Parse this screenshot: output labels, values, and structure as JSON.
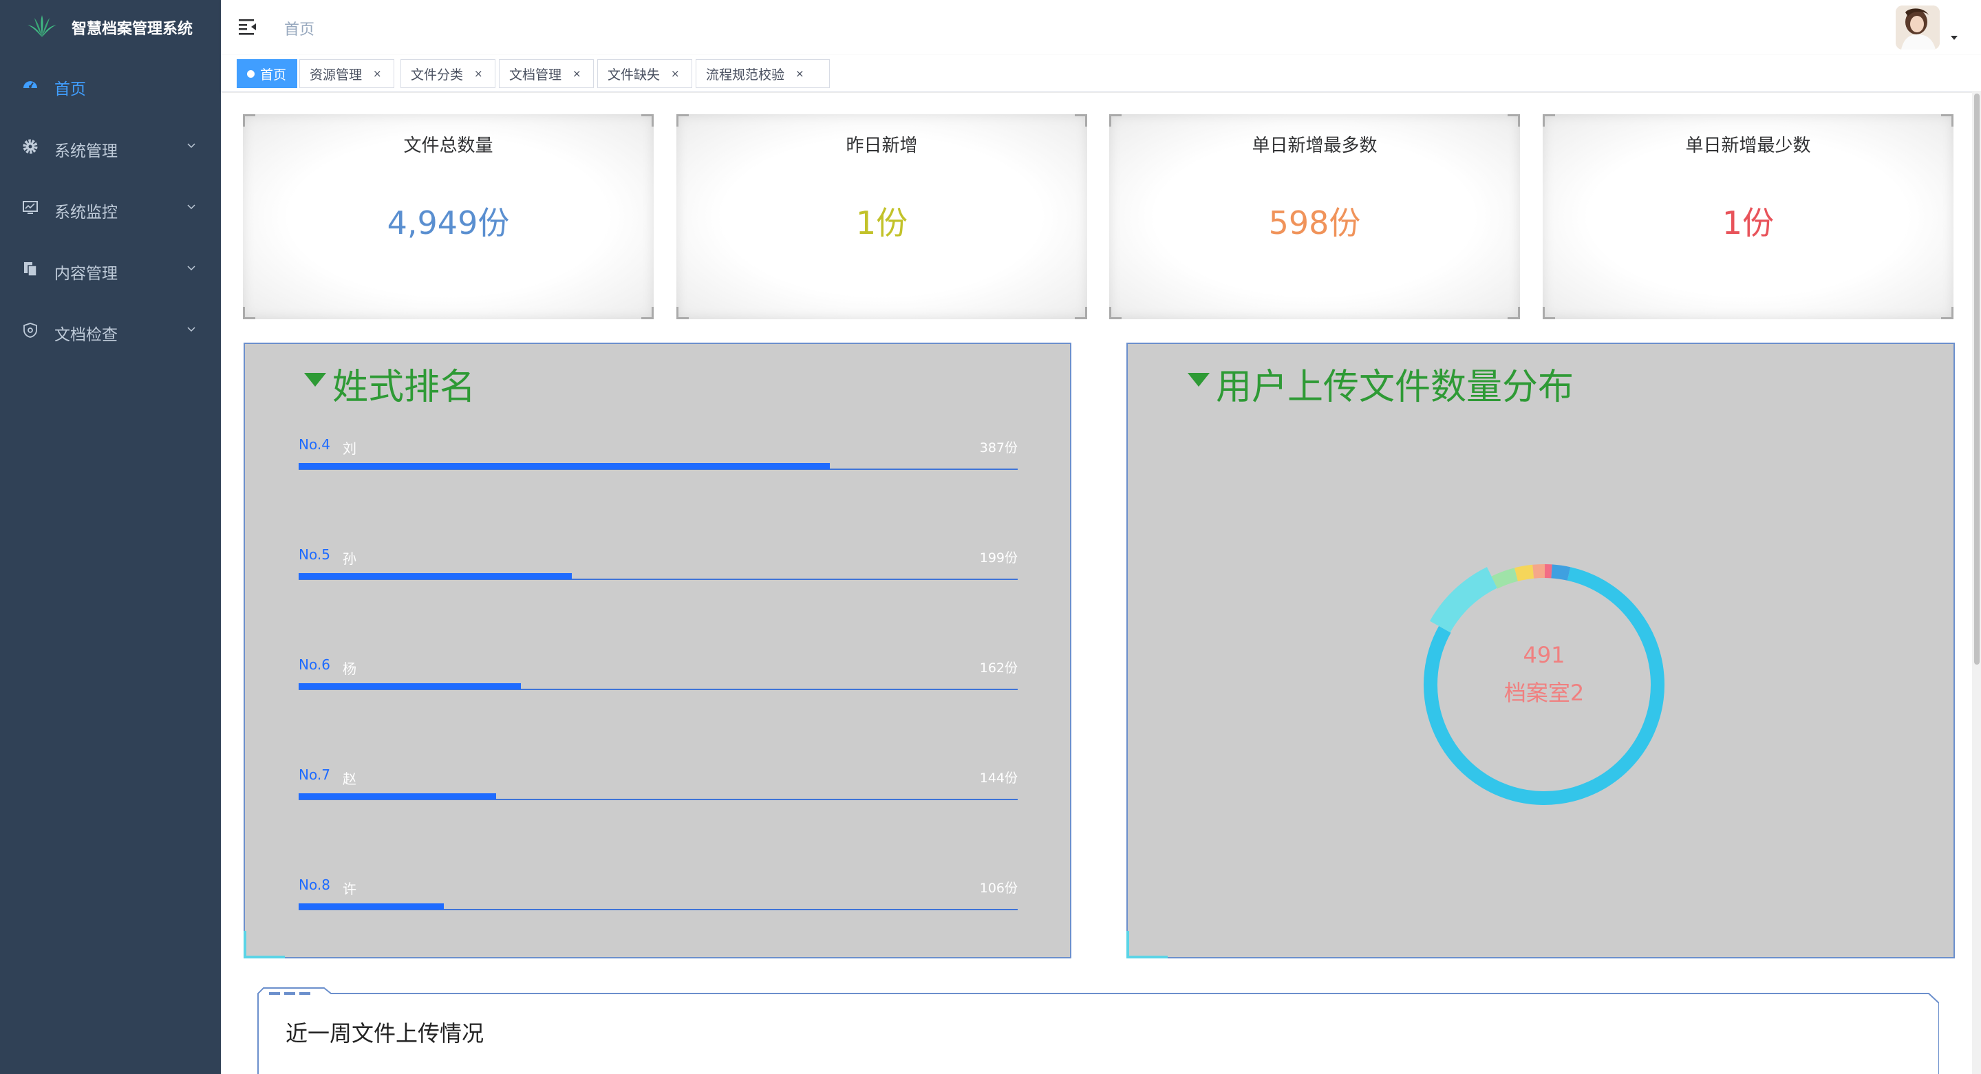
{
  "app": {
    "title": "智慧档案管理系统"
  },
  "sidebar": {
    "items": [
      {
        "label": "首页",
        "icon": "dashboard-icon",
        "active": true
      },
      {
        "label": "系统管理",
        "icon": "gear-icon"
      },
      {
        "label": "系统监控",
        "icon": "monitor-icon"
      },
      {
        "label": "内容管理",
        "icon": "documents-icon"
      },
      {
        "label": "文档检查",
        "icon": "shield-check-icon"
      }
    ]
  },
  "navbar": {
    "breadcrumb": "首页"
  },
  "tags": [
    {
      "label": "首页",
      "active": true
    },
    {
      "label": "资源管理",
      "close": "×"
    },
    {
      "label": "文件分类",
      "close": "×"
    },
    {
      "label": "文档管理",
      "close": "×"
    },
    {
      "label": "文件缺失",
      "close": "×"
    },
    {
      "label": "流程规范校验",
      "close": "×"
    }
  ],
  "stats": [
    {
      "title": "文件总数量",
      "value": "4,949份",
      "color": "#5a8fd0"
    },
    {
      "title": "昨日新增",
      "value": "1份",
      "color": "#c2c22a"
    },
    {
      "title": "单日新增最多数",
      "value": "598份",
      "color": "#f0935a"
    },
    {
      "title": "单日新增最少数",
      "value": "1份",
      "color": "#e8535a"
    }
  ],
  "surname_panel": {
    "title": "姓式排名",
    "items": [
      {
        "no": "No.4",
        "name": "刘",
        "value": "387份",
        "count": 387
      },
      {
        "no": "No.5",
        "name": "孙",
        "value": "199份",
        "count": 199
      },
      {
        "no": "No.6",
        "name": "杨",
        "value": "162份",
        "count": 162
      },
      {
        "no": "No.7",
        "name": "赵",
        "value": "144份",
        "count": 144
      },
      {
        "no": "No.8",
        "name": "许",
        "value": "106份",
        "count": 106
      }
    ]
  },
  "upload_panel": {
    "title": "用户上传文件数量分布",
    "center_value": "491",
    "center_label": "档案室2"
  },
  "chart_data": {
    "type": "pie",
    "series": [
      {
        "values": [
          491,
          60,
          20,
          15,
          10,
          6,
          15
        ]
      }
    ],
    "colors": [
      "#33c5ea",
      "#6fdfe8",
      "#9fe3a8",
      "#f5d65a",
      "#f5a78a",
      "#f26d85",
      "#3fa0e0"
    ]
  },
  "weekly_panel": {
    "title": "近一周文件上传情况"
  }
}
